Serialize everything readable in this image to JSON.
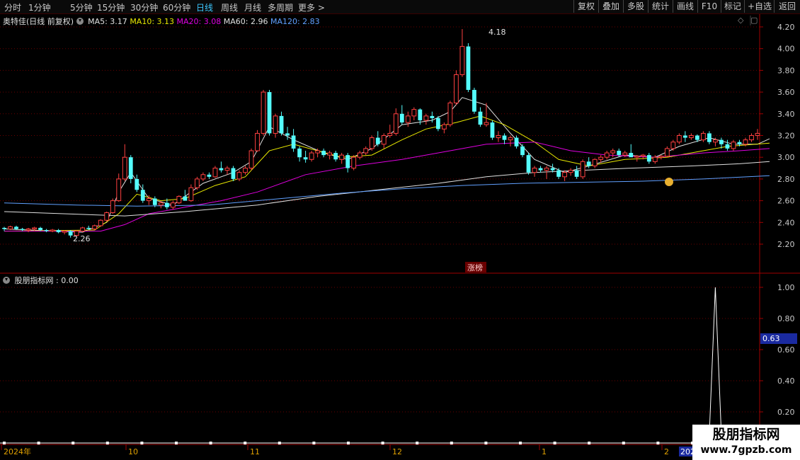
{
  "toolbar": {
    "tabs": [
      "分时",
      "1分钟",
      "5分钟",
      "15分钟",
      "30分钟",
      "60分钟",
      "日线",
      "周线",
      "月线",
      "多周期",
      "更多 >"
    ],
    "active_tab": "日线",
    "right_buttons": [
      "复权",
      "叠加",
      "多股",
      "统计",
      "画线",
      "F10",
      "标记",
      "+自选",
      "返回"
    ]
  },
  "main_legend": {
    "stock": "奥特佳(日线 前复权)",
    "ma": [
      {
        "label": "MA5: 3.17",
        "color": "#e0e0e0"
      },
      {
        "label": "MA10: 3.13",
        "color": "#e8e800"
      },
      {
        "label": "MA20: 3.08",
        "color": "#e000e0"
      },
      {
        "label": "MA60: 2.96",
        "color": "#e0e0e0"
      },
      {
        "label": "MA120: 2.83",
        "color": "#60a0ff"
      }
    ]
  },
  "price_axis": [
    "4.20",
    "4.00",
    "3.80",
    "3.60",
    "3.40",
    "3.20",
    "3.00",
    "2.80",
    "2.60",
    "2.40",
    "2.20"
  ],
  "annotations": {
    "high": "4.18",
    "low": "2.26",
    "limit_tag": "涨榜"
  },
  "indicator": {
    "legend": "股朋指标网 : 0.00",
    "axis": [
      "1.00",
      "0.80",
      "0.60",
      "0.40",
      "0.20"
    ],
    "cursor_value": "0.63"
  },
  "time_axis": {
    "labels": [
      {
        "label": "2024年",
        "x": 2
      },
      {
        "label": "10",
        "x": 178
      },
      {
        "label": "11",
        "x": 350
      },
      {
        "label": "12",
        "x": 551
      },
      {
        "label": "1",
        "x": 762
      },
      {
        "label": "2",
        "x": 935
      }
    ],
    "year_box": "2025"
  },
  "watermark": {
    "line1": "股朋指标网",
    "line2": "www.7gpzb.com"
  },
  "colors": {
    "up": "#ff4040",
    "down": "#54fcfc",
    "grid": "#6a0000",
    "axis": "#a00000"
  },
  "chart_data": {
    "type": "candlestick",
    "ylim": [
      2.1,
      4.28
    ],
    "candles": [
      [
        2.35,
        2.36,
        2.32,
        2.34
      ],
      [
        2.34,
        2.37,
        2.33,
        2.36
      ],
      [
        2.36,
        2.37,
        2.33,
        2.34
      ],
      [
        2.34,
        2.35,
        2.32,
        2.33
      ],
      [
        2.33,
        2.35,
        2.31,
        2.34
      ],
      [
        2.34,
        2.36,
        2.32,
        2.35
      ],
      [
        2.35,
        2.36,
        2.32,
        2.33
      ],
      [
        2.33,
        2.34,
        2.31,
        2.32
      ],
      [
        2.32,
        2.34,
        2.31,
        2.33
      ],
      [
        2.33,
        2.34,
        2.3,
        2.31
      ],
      [
        2.31,
        2.33,
        2.29,
        2.32
      ],
      [
        2.32,
        2.33,
        2.26,
        2.28
      ],
      [
        2.28,
        2.33,
        2.27,
        2.32
      ],
      [
        2.32,
        2.36,
        2.31,
        2.35
      ],
      [
        2.35,
        2.37,
        2.33,
        2.34
      ],
      [
        2.34,
        2.38,
        2.33,
        2.37
      ],
      [
        2.37,
        2.43,
        2.36,
        2.42
      ],
      [
        2.42,
        2.5,
        2.41,
        2.49
      ],
      [
        2.49,
        2.62,
        2.48,
        2.6
      ],
      [
        2.6,
        2.85,
        2.59,
        2.8
      ],
      [
        2.8,
        3.12,
        2.78,
        3.0
      ],
      [
        3.0,
        3.02,
        2.76,
        2.8
      ],
      [
        2.8,
        2.84,
        2.68,
        2.7
      ],
      [
        2.7,
        2.75,
        2.58,
        2.6
      ],
      [
        2.6,
        2.65,
        2.56,
        2.62
      ],
      [
        2.62,
        2.64,
        2.54,
        2.56
      ],
      [
        2.56,
        2.6,
        2.53,
        2.58
      ],
      [
        2.58,
        2.62,
        2.52,
        2.54
      ],
      [
        2.54,
        2.6,
        2.52,
        2.58
      ],
      [
        2.58,
        2.65,
        2.57,
        2.64
      ],
      [
        2.64,
        2.7,
        2.62,
        2.6
      ],
      [
        2.6,
        2.75,
        2.59,
        2.72
      ],
      [
        2.72,
        2.82,
        2.7,
        2.8
      ],
      [
        2.8,
        2.86,
        2.78,
        2.84
      ],
      [
        2.84,
        2.86,
        2.8,
        2.82
      ],
      [
        2.82,
        2.92,
        2.81,
        2.9
      ],
      [
        2.9,
        2.96,
        2.86,
        2.88
      ],
      [
        2.88,
        2.92,
        2.84,
        2.9
      ],
      [
        2.9,
        2.92,
        2.78,
        2.8
      ],
      [
        2.8,
        2.88,
        2.78,
        2.86
      ],
      [
        2.86,
        2.92,
        2.84,
        2.9
      ],
      [
        2.9,
        3.08,
        2.88,
        3.06
      ],
      [
        3.06,
        3.25,
        3.05,
        3.22
      ],
      [
        3.22,
        3.62,
        3.2,
        3.6
      ],
      [
        3.6,
        3.62,
        3.2,
        3.22
      ],
      [
        3.22,
        3.4,
        3.18,
        3.38
      ],
      [
        3.38,
        3.42,
        3.2,
        3.22
      ],
      [
        3.22,
        3.28,
        3.16,
        3.2
      ],
      [
        3.2,
        3.26,
        3.05,
        3.08
      ],
      [
        3.08,
        3.1,
        2.96,
        3.0
      ],
      [
        3.0,
        3.06,
        2.95,
        2.98
      ],
      [
        2.98,
        3.06,
        2.96,
        3.04
      ],
      [
        3.04,
        3.08,
        3.0,
        3.06
      ],
      [
        3.06,
        3.08,
        3.0,
        3.02
      ],
      [
        3.02,
        3.06,
        2.98,
        3.04
      ],
      [
        3.04,
        3.06,
        2.96,
        2.98
      ],
      [
        2.98,
        3.04,
        2.94,
        3.02
      ],
      [
        3.02,
        3.04,
        2.86,
        2.9
      ],
      [
        2.9,
        3.02,
        2.88,
        3.0
      ],
      [
        3.0,
        3.06,
        2.98,
        3.04
      ],
      [
        3.04,
        3.1,
        3.02,
        3.08
      ],
      [
        3.08,
        3.2,
        3.06,
        3.18
      ],
      [
        3.18,
        3.24,
        3.1,
        3.12
      ],
      [
        3.12,
        3.22,
        3.08,
        3.2
      ],
      [
        3.2,
        3.3,
        3.18,
        3.22
      ],
      [
        3.22,
        3.45,
        3.2,
        3.4
      ],
      [
        3.4,
        3.48,
        3.3,
        3.32
      ],
      [
        3.32,
        3.42,
        3.28,
        3.38
      ],
      [
        3.38,
        3.46,
        3.34,
        3.44
      ],
      [
        3.44,
        3.45,
        3.3,
        3.34
      ],
      [
        3.34,
        3.4,
        3.3,
        3.38
      ],
      [
        3.38,
        3.42,
        3.32,
        3.36
      ],
      [
        3.36,
        3.38,
        3.24,
        3.26
      ],
      [
        3.26,
        3.32,
        3.22,
        3.3
      ],
      [
        3.3,
        3.52,
        3.28,
        3.5
      ],
      [
        3.5,
        3.8,
        3.48,
        3.76
      ],
      [
        3.76,
        4.18,
        3.74,
        4.02
      ],
      [
        4.02,
        4.05,
        3.6,
        3.62
      ],
      [
        3.62,
        3.64,
        3.4,
        3.42
      ],
      [
        3.42,
        3.46,
        3.28,
        3.3
      ],
      [
        3.3,
        3.5,
        3.28,
        3.32
      ],
      [
        3.32,
        3.34,
        3.16,
        3.18
      ],
      [
        3.18,
        3.24,
        3.14,
        3.2
      ],
      [
        3.2,
        3.22,
        3.12,
        3.16
      ],
      [
        3.16,
        3.2,
        3.1,
        3.18
      ],
      [
        3.18,
        3.2,
        3.08,
        3.1
      ],
      [
        3.1,
        3.12,
        3.0,
        3.02
      ],
      [
        3.02,
        3.04,
        2.84,
        2.86
      ],
      [
        2.86,
        2.92,
        2.82,
        2.9
      ],
      [
        2.9,
        2.92,
        2.86,
        2.88
      ],
      [
        2.88,
        2.92,
        2.8,
        2.9
      ],
      [
        2.9,
        2.94,
        2.86,
        2.88
      ],
      [
        2.88,
        2.9,
        2.8,
        2.82
      ],
      [
        2.82,
        2.88,
        2.78,
        2.86
      ],
      [
        2.86,
        2.9,
        2.83,
        2.88
      ],
      [
        2.88,
        2.92,
        2.8,
        2.82
      ],
      [
        2.82,
        2.98,
        2.8,
        2.96
      ],
      [
        2.96,
        3.0,
        2.9,
        2.92
      ],
      [
        2.92,
        2.99,
        2.9,
        2.98
      ],
      [
        2.98,
        3.02,
        2.95,
        3.0
      ],
      [
        3.0,
        3.06,
        2.98,
        3.04
      ],
      [
        3.04,
        3.08,
        3.0,
        3.06
      ],
      [
        3.06,
        3.08,
        3.0,
        3.02
      ],
      [
        3.02,
        3.06,
        3.0,
        3.04
      ],
      [
        3.04,
        3.12,
        3.02,
        3.0
      ],
      [
        3.0,
        3.02,
        2.96,
        3.01
      ],
      [
        3.01,
        3.03,
        2.98,
        3.02
      ],
      [
        3.02,
        3.04,
        2.94,
        2.96
      ],
      [
        2.96,
        3.02,
        2.94,
        3.0
      ],
      [
        3.0,
        3.02,
        2.98,
        3.01
      ],
      [
        3.01,
        3.1,
        3.0,
        3.08
      ],
      [
        3.08,
        3.16,
        3.06,
        3.14
      ],
      [
        3.14,
        3.22,
        3.12,
        3.2
      ],
      [
        3.2,
        3.24,
        3.14,
        3.18
      ],
      [
        3.18,
        3.22,
        3.16,
        3.2
      ],
      [
        3.2,
        3.21,
        3.14,
        3.16
      ],
      [
        3.16,
        3.24,
        3.14,
        3.22
      ],
      [
        3.22,
        3.24,
        3.12,
        3.14
      ],
      [
        3.14,
        3.18,
        3.1,
        3.16
      ],
      [
        3.16,
        3.18,
        3.08,
        3.12
      ],
      [
        3.12,
        3.16,
        3.06,
        3.08
      ],
      [
        3.08,
        3.16,
        3.06,
        3.14
      ],
      [
        3.14,
        3.16,
        3.1,
        3.12
      ],
      [
        3.12,
        3.18,
        3.1,
        3.16
      ],
      [
        3.16,
        3.22,
        3.14,
        3.2
      ],
      [
        3.2,
        3.26,
        3.16,
        3.22
      ]
    ],
    "ma_series": [
      {
        "name": "MA5",
        "color": "#e0e0e0",
        "points": [
          [
            0,
            2.34
          ],
          [
            13,
            2.31
          ],
          [
            17,
            2.4
          ],
          [
            19,
            2.68
          ],
          [
            21,
            2.86
          ],
          [
            24,
            2.62
          ],
          [
            28,
            2.56
          ],
          [
            33,
            2.76
          ],
          [
            38,
            2.86
          ],
          [
            41,
            2.96
          ],
          [
            44,
            3.28
          ],
          [
            48,
            3.16
          ],
          [
            53,
            3.04
          ],
          [
            57,
            2.98
          ],
          [
            61,
            3.08
          ],
          [
            66,
            3.3
          ],
          [
            71,
            3.34
          ],
          [
            74,
            3.42
          ],
          [
            76,
            3.55
          ],
          [
            80,
            3.48
          ],
          [
            84,
            3.22
          ],
          [
            88,
            2.98
          ],
          [
            93,
            2.86
          ],
          [
            97,
            2.92
          ],
          [
            103,
            3.02
          ],
          [
            108,
            3.0
          ],
          [
            112,
            3.1
          ],
          [
            117,
            3.18
          ],
          [
            121,
            3.12
          ],
          [
            125,
            3.12
          ],
          [
            127,
            3.17
          ]
        ]
      },
      {
        "name": "MA10",
        "color": "#e8e800",
        "points": [
          [
            0,
            2.32
          ],
          [
            15,
            2.33
          ],
          [
            19,
            2.48
          ],
          [
            22,
            2.66
          ],
          [
            26,
            2.6
          ],
          [
            30,
            2.62
          ],
          [
            35,
            2.74
          ],
          [
            40,
            2.82
          ],
          [
            44,
            3.06
          ],
          [
            48,
            3.12
          ],
          [
            52,
            3.06
          ],
          [
            56,
            3.0
          ],
          [
            61,
            3.02
          ],
          [
            66,
            3.16
          ],
          [
            70,
            3.26
          ],
          [
            75,
            3.32
          ],
          [
            79,
            3.38
          ],
          [
            83,
            3.3
          ],
          [
            88,
            3.14
          ],
          [
            92,
            2.98
          ],
          [
            97,
            2.92
          ],
          [
            103,
            2.98
          ],
          [
            110,
            3.0
          ],
          [
            116,
            3.06
          ],
          [
            120,
            3.1
          ],
          [
            127,
            3.13
          ]
        ]
      },
      {
        "name": "MA20",
        "color": "#e000e0",
        "points": [
          [
            0,
            2.32
          ],
          [
            16,
            2.32
          ],
          [
            20,
            2.38
          ],
          [
            24,
            2.48
          ],
          [
            30,
            2.54
          ],
          [
            36,
            2.6
          ],
          [
            42,
            2.68
          ],
          [
            50,
            2.84
          ],
          [
            58,
            2.92
          ],
          [
            66,
            2.98
          ],
          [
            74,
            3.06
          ],
          [
            80,
            3.12
          ],
          [
            88,
            3.14
          ],
          [
            94,
            3.06
          ],
          [
            100,
            3.02
          ],
          [
            108,
            3.0
          ],
          [
            116,
            3.04
          ],
          [
            122,
            3.06
          ],
          [
            127,
            3.08
          ]
        ]
      },
      {
        "name": "MA60",
        "color": "#e0e0e0",
        "points": [
          [
            0,
            2.5
          ],
          [
            20,
            2.46
          ],
          [
            30,
            2.5
          ],
          [
            42,
            2.56
          ],
          [
            52,
            2.64
          ],
          [
            62,
            2.7
          ],
          [
            72,
            2.76
          ],
          [
            80,
            2.82
          ],
          [
            88,
            2.86
          ],
          [
            96,
            2.88
          ],
          [
            104,
            2.9
          ],
          [
            114,
            2.92
          ],
          [
            122,
            2.94
          ],
          [
            127,
            2.96
          ]
        ]
      },
      {
        "name": "MA120",
        "color": "#60a0ff",
        "points": [
          [
            0,
            2.58
          ],
          [
            12,
            2.56
          ],
          [
            22,
            2.55
          ],
          [
            34,
            2.56
          ],
          [
            46,
            2.62
          ],
          [
            56,
            2.67
          ],
          [
            66,
            2.71
          ],
          [
            76,
            2.74
          ],
          [
            86,
            2.76
          ],
          [
            96,
            2.77
          ],
          [
            106,
            2.78
          ],
          [
            116,
            2.8
          ],
          [
            127,
            2.83
          ]
        ]
      }
    ],
    "indicator_series": {
      "baseline": 0,
      "spike_index": 118,
      "spike_value": 1.0
    }
  }
}
